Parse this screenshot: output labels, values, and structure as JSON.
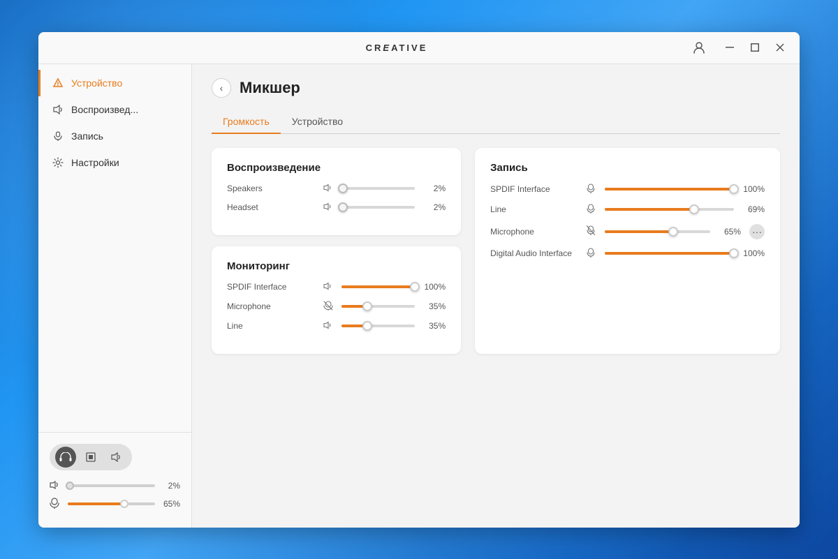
{
  "window": {
    "title": "CREATIVE",
    "min_label": "—",
    "max_label": "⬜",
    "close_label": "✕"
  },
  "sidebar": {
    "items": [
      {
        "id": "device",
        "label": "Устройство",
        "icon": "🔔",
        "active": true
      },
      {
        "id": "playback",
        "label": "Воспроизвед...",
        "icon": "🔊",
        "active": false
      },
      {
        "id": "record",
        "label": "Запись",
        "icon": "🎤",
        "active": false
      },
      {
        "id": "settings",
        "label": "Настройки",
        "icon": "⚙",
        "active": false
      }
    ],
    "device_icons": [
      {
        "id": "headphone",
        "icon": "🎧",
        "active": true
      },
      {
        "id": "square",
        "icon": "⬛",
        "active": false
      },
      {
        "id": "speaker",
        "icon": "🔈",
        "active": false
      }
    ],
    "bottom_sliders": [
      {
        "id": "volume",
        "icon": "🔊",
        "value_pct": 2,
        "value_label": "2%",
        "thumb_pct": 2,
        "orange": false
      },
      {
        "id": "mic",
        "icon": "🎤",
        "value_pct": 65,
        "value_label": "65%",
        "thumb_pct": 65,
        "orange": true
      }
    ]
  },
  "content": {
    "back_label": "‹",
    "page_title": "Микшер",
    "tabs": [
      {
        "id": "volume",
        "label": "Громкость",
        "active": true
      },
      {
        "id": "device",
        "label": "Устройство",
        "active": false
      }
    ],
    "playback_card": {
      "title": "Воспроизведение",
      "sliders": [
        {
          "id": "speakers",
          "label": "Speakers",
          "icon": "🔊",
          "value_pct": 2,
          "value_label": "2%",
          "thumb_pct": 2
        },
        {
          "id": "headset",
          "label": "Headset",
          "icon": "🔊",
          "value_pct": 2,
          "value_label": "2%",
          "thumb_pct": 2
        }
      ]
    },
    "monitoring_card": {
      "title": "Мониторинг",
      "sliders": [
        {
          "id": "spdif",
          "label": "SPDIF Interface",
          "icon": "🔊",
          "value_pct": 100,
          "value_label": "100%",
          "thumb_pct": 100
        },
        {
          "id": "microphone",
          "label": "Microphone",
          "icon": "🔇",
          "value_pct": 35,
          "value_label": "35%",
          "thumb_pct": 35
        },
        {
          "id": "line",
          "label": "Line",
          "icon": "🔊",
          "value_pct": 35,
          "value_label": "35%",
          "thumb_pct": 35
        }
      ]
    },
    "record_card": {
      "title": "Запись",
      "sliders": [
        {
          "id": "spdif",
          "label": "SPDIF Interface",
          "icon": "🎤",
          "value_pct": 100,
          "value_label": "100%",
          "thumb_pct": 100,
          "has_more": false
        },
        {
          "id": "line",
          "label": "Line",
          "icon": "🎤",
          "value_pct": 69,
          "value_label": "69%",
          "thumb_pct": 69,
          "has_more": false
        },
        {
          "id": "microphone",
          "label": "Microphone",
          "icon": "🎤",
          "value_pct": 65,
          "value_label": "65%",
          "thumb_pct": 65,
          "has_more": true
        },
        {
          "id": "digital",
          "label": "Digital Audio Interface",
          "icon": "🎤",
          "value_pct": 100,
          "value_label": "100%",
          "thumb_pct": 100,
          "has_more": false
        }
      ]
    }
  }
}
